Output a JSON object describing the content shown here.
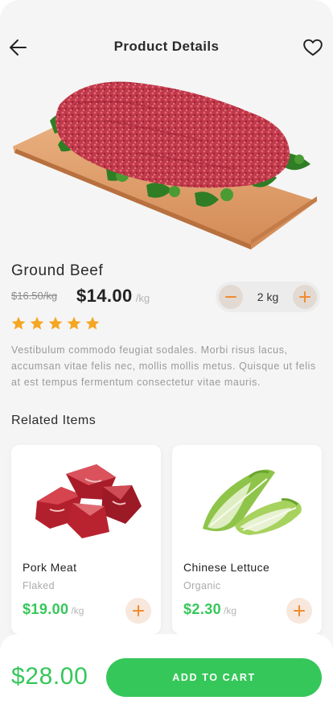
{
  "header": {
    "title": "Product Details"
  },
  "product": {
    "name": "Ground Beef",
    "old_price": "$16.50/kg",
    "price": "$14.00",
    "unit": "/kg",
    "quantity": "2 kg",
    "rating": 5,
    "description": "Vestibulum commodo feugiat sodales. Morbi risus lacus, accumsan vitae felis nec, mollis mollis metus. Quisque ut felis at est tempus fermentum consectetur vitae mauris."
  },
  "related": {
    "title": "Related Items",
    "items": [
      {
        "name": "Pork Meat",
        "subtitle": "Flaked",
        "price": "$19.00",
        "unit": "/kg"
      },
      {
        "name": "Chinese Lettuce",
        "subtitle": "Organic",
        "price": "$2.30",
        "unit": "/kg"
      }
    ]
  },
  "footer": {
    "total": "$28.00",
    "cart_label": "ADD TO CART"
  },
  "colors": {
    "accent_green": "#35c75a",
    "accent_orange": "#f08c2e",
    "star_yellow": "#f5a623"
  },
  "icons": [
    "arrow-left-icon",
    "heart-icon",
    "minus-icon",
    "plus-icon",
    "star-icon"
  ]
}
